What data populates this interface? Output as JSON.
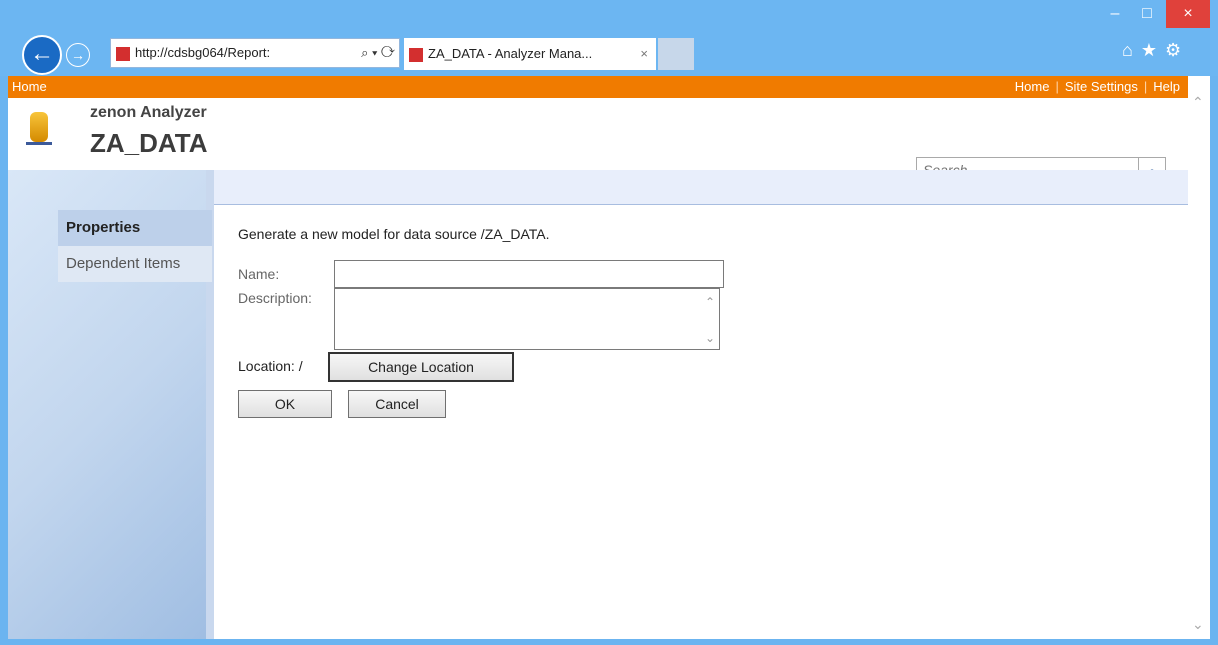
{
  "browser": {
    "address": "http://cdsbg064/Report:",
    "tab_title": "ZA_DATA - Analyzer Mana...",
    "tab_close": "×",
    "window_min": "–",
    "window_max": "□",
    "window_close": "×",
    "back_glyph": "←",
    "forward_glyph": "→",
    "address_tools": "⌕ ▾ ⟳",
    "toolicons": "⌂★⚙"
  },
  "topnav": {
    "home": "Home",
    "links": [
      "Home",
      "Site Settings",
      "Help"
    ],
    "separator": "|"
  },
  "header": {
    "site_name": "zenon Analyzer",
    "page_title": "ZA_DATA",
    "search_placeholder": "Search",
    "search_icon": "⌕"
  },
  "sidebar": {
    "items": [
      {
        "label": "Properties",
        "active": true
      },
      {
        "label": "Dependent Items",
        "active": false
      }
    ]
  },
  "form": {
    "intro": "Generate a new model for data source /ZA_DATA.",
    "name_label": "Name:",
    "name_value": "",
    "description_label": "Description:",
    "description_value": "",
    "location_label": "Location: /",
    "change_location": "Change Location",
    "ok": "OK",
    "cancel": "Cancel"
  },
  "colors": {
    "topnav_bg": "#f07b00",
    "titlebar_bg": "#6cb6f2",
    "close_btn": "#e0413b"
  }
}
